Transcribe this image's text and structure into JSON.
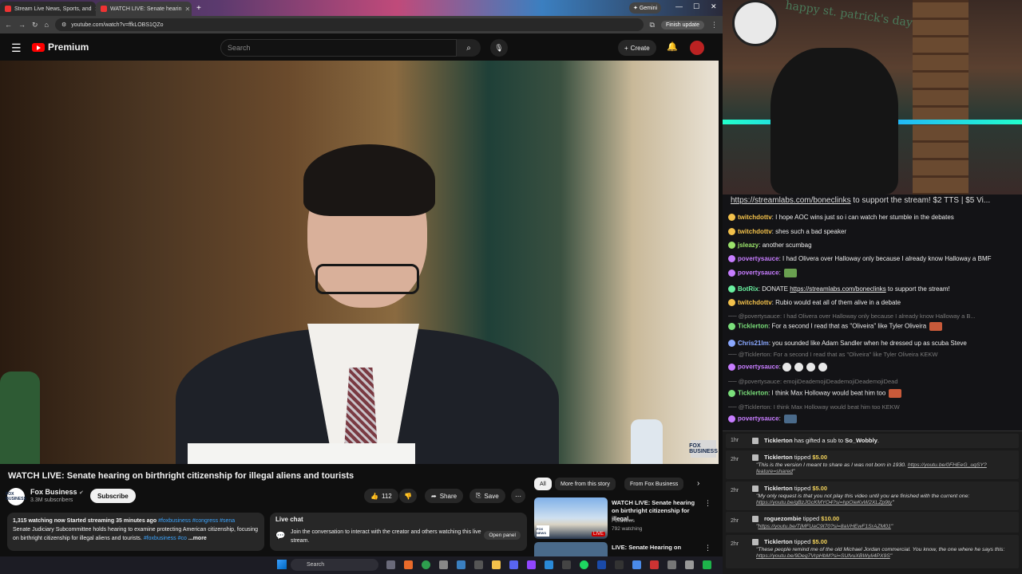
{
  "browser": {
    "tabs": [
      {
        "label": "Stream Live News, Sports, and"
      },
      {
        "label": "WATCH LIVE: Senate hearin"
      }
    ],
    "gemini_label": "Gemini",
    "url": "youtube.com/watch?v=ffkLOBS1QZo",
    "finish_update_label": "Finish update"
  },
  "youtube": {
    "logo_text": "Premium",
    "search_placeholder": "Search",
    "create_label": "Create",
    "video": {
      "title": "WATCH LIVE: Senate hearing on birthright citizenship for illegal aliens and tourists",
      "channel": "Fox Business",
      "channel_avatar_text": "FOX BUSINESS",
      "subscribers": "3.3M subscribers",
      "subscribe_label": "Subscribe",
      "likes": "112",
      "share_label": "Share",
      "save_label": "Save",
      "watermark": "FOX BUSINESS"
    },
    "description": {
      "meta": "1,315 watching now  Started streaming 35 minutes ago",
      "tags": "#foxbusiness #congress #sena",
      "text": "Senate Judiciary Subcommittee holds hearing to examine protecting American citizenship, focusing on birthright citizenship for illegal aliens and tourists.",
      "text_tags": "#foxbusiness #co",
      "more": "...more"
    },
    "live_chat": {
      "title": "Live chat",
      "body": "Join the conversation to interact with the creator and others watching this live stream.",
      "open_panel": "Open panel"
    },
    "chips": [
      "All",
      "More from this story",
      "From Fox Business"
    ],
    "recommendations": [
      {
        "title": "WATCH LIVE: Senate hearing on birthright citizenship for illegal...",
        "channel": "Fox News",
        "meta": "792 watching",
        "badge": "LIVE",
        "thumb_logo": "FOX NEWS"
      },
      {
        "title": "LIVE: Senate Hearing on",
        "channel": "",
        "meta": ""
      }
    ]
  },
  "taskbar": {
    "search_placeholder": "Search"
  },
  "stream": {
    "wall_text": "happy st. patrick's day",
    "pinned": {
      "link": "https://streamlabs.com/boneclinks",
      "text": " to support the stream! $2 TTS | $5 Vi..."
    },
    "messages": [
      {
        "user": "twitchdottv",
        "text": ": I hope AOC wins just so i can watch her stumble in the debates",
        "color": "#f3c14b"
      },
      {
        "user": "twitchdottv",
        "text": ": shes such a bad speaker",
        "color": "#f3c14b"
      },
      {
        "user": "jsleazy",
        "text": ": another scumbag",
        "color": "#9be36b"
      },
      {
        "user": "povertysauce",
        "text": ": I had Olivera over Halloway only because I already know Halloway a BMF",
        "color": "#c77dff"
      },
      {
        "user": "povertysauce",
        "text": ":",
        "color": "#c77dff"
      },
      {
        "user": "BotRix",
        "text": ": DONATE ",
        "link": "https://streamlabs.com/boneclinks",
        "after": " to support the stream!",
        "color": "#6af0a0"
      },
      {
        "user": "twitchdottv",
        "text": ": Rubio would eat all of them alive in a debate",
        "color": "#f3c14b"
      },
      {
        "reply": "@povertysauce: I had Olivera over Halloway only because I already know Halloway a B..."
      },
      {
        "user": "Ticklerton",
        "text": ": For a second I read that as \"Oliveira\" like Tyler Oliveira",
        "color": "#7be07b"
      },
      {
        "user": "Chris21Im",
        "text": ": you sounded like Adam Sandler when he dressed up as scuba Steve",
        "color": "#8aa8ff"
      },
      {
        "reply": "@Ticklerton: For a second I read that as \"Oliveira\" like Tyler Oliveira KEKW"
      },
      {
        "user": "povertysauce",
        "text": ":",
        "color": "#c77dff"
      },
      {
        "reply": "@povertysauce: emojiDeademojiDeademojiDeademojiDead"
      },
      {
        "user": "Ticklerton",
        "text": ": I think Max Holloway would beat him too",
        "color": "#7be07b"
      },
      {
        "reply": "@Ticklerton: I think Max Holloway would beat him too KEKW"
      },
      {
        "user": "povertysauce",
        "text": ":",
        "color": "#c77dff"
      }
    ],
    "events": [
      {
        "time": "1hr",
        "user": "Ticklerton",
        "text": " has gifted a sub to ",
        "target": "So_Wobbly",
        "end": "."
      },
      {
        "time": "2hr",
        "user": "Ticklerton",
        "text": " tipped ",
        "amount": "$5.00",
        "quote": "\"This is the version I meant to share as I was not born in 1930. ",
        "quote_link": "https://youtu.be/0FHEeG_uqSY?feature=shared",
        "quote_end": "\""
      },
      {
        "time": "2hr",
        "user": "Ticklerton",
        "text": " tipped ",
        "amount": "$5.00",
        "quote": "\"My only request is that you not play this video until you are finished with the current one: ",
        "quote_link": "https://youtu.be/gBzJGcKMYO4?si=hpOieKvW2XLZp9ty",
        "quote_end": "\""
      },
      {
        "time": "2hr",
        "user": "roguezombie",
        "text": " tipped ",
        "amount": "$10.00",
        "quote": "\"",
        "quote_link": "https://youtu.be/TjMFUaC9I70?si=8aVHEwF1SrAZM01",
        "quote_end": "\""
      },
      {
        "time": "2hr",
        "user": "Ticklerton",
        "text": " tipped ",
        "amount": "$5.00",
        "quote": "\"These people remind me of the old Michael Jordan commercial. You know, the one where he says this: ",
        "quote_link": "https://youtu.be/9Deg7VrpHbM?si=SUfvuXBWyIi4PX9S",
        "quote_end": "\""
      }
    ]
  },
  "colors": {
    "yt_red": "#ff0000",
    "link_blue": "#3ea6ff",
    "tip_gold": "#f3d35b"
  }
}
